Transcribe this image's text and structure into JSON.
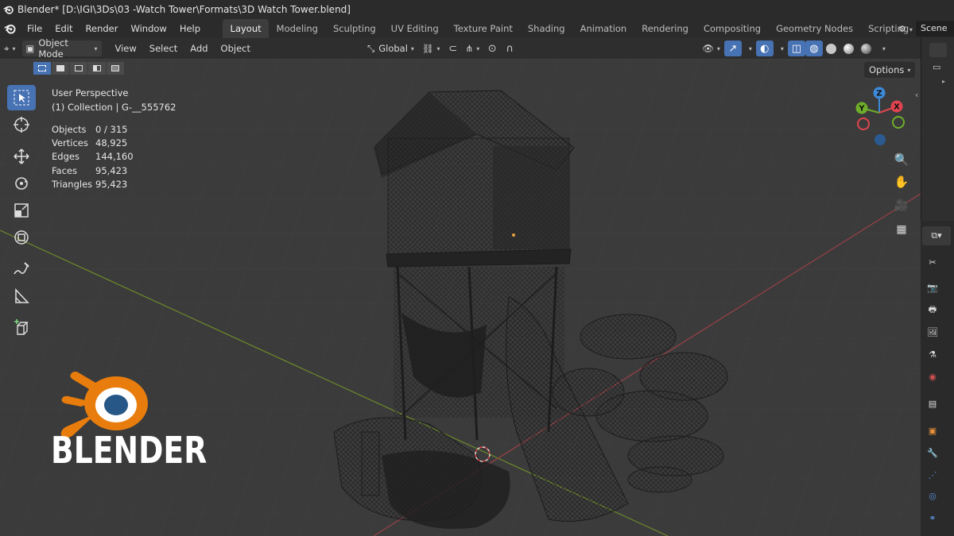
{
  "window": {
    "title": "Blender* [D:\\IGI\\3Ds\\03 -Watch Tower\\Formats\\3D Watch Tower.blend]"
  },
  "menu": {
    "items": [
      "File",
      "Edit",
      "Render",
      "Window",
      "Help"
    ]
  },
  "workspaces": {
    "tabs": [
      {
        "label": "Layout",
        "active": true
      },
      {
        "label": "Modeling"
      },
      {
        "label": "Sculpting"
      },
      {
        "label": "UV Editing"
      },
      {
        "label": "Texture Paint"
      },
      {
        "label": "Shading"
      },
      {
        "label": "Animation"
      },
      {
        "label": "Rendering"
      },
      {
        "label": "Compositing"
      },
      {
        "label": "Geometry Nodes"
      },
      {
        "label": "Scripting"
      }
    ],
    "add_label": "+"
  },
  "scene": {
    "name": "Scene"
  },
  "viewport_header": {
    "mode": "Object Mode",
    "menus": [
      "View",
      "Select",
      "Add",
      "Object"
    ],
    "orientation": "Global",
    "options_label": "Options"
  },
  "overlay": {
    "view_name": "User Perspective",
    "collection": "(1) Collection | G-__555762",
    "stats": [
      {
        "label": "Objects",
        "value": "0 / 315"
      },
      {
        "label": "Vertices",
        "value": "48,925"
      },
      {
        "label": "Edges",
        "value": "144,160"
      },
      {
        "label": "Faces",
        "value": "95,423"
      },
      {
        "label": "Triangles",
        "value": "95,423"
      }
    ]
  },
  "gizmo": {
    "axes": {
      "z": "Z",
      "y": "Y",
      "x": "X"
    },
    "colors": {
      "x": "#e0444e",
      "y": "#6fae2a",
      "z": "#3d8ad8"
    }
  },
  "branding": {
    "wordmark": "BLENDER",
    "colors": {
      "orange": "#e87d0d",
      "blue": "#265787"
    }
  },
  "theme": {
    "accent": "#4772b3",
    "viewport_bg": "#3b3b3b",
    "header_bg": "#2e2e2e",
    "x_axis_line": "#9a4048",
    "y_axis_line": "#6d8a2a"
  }
}
